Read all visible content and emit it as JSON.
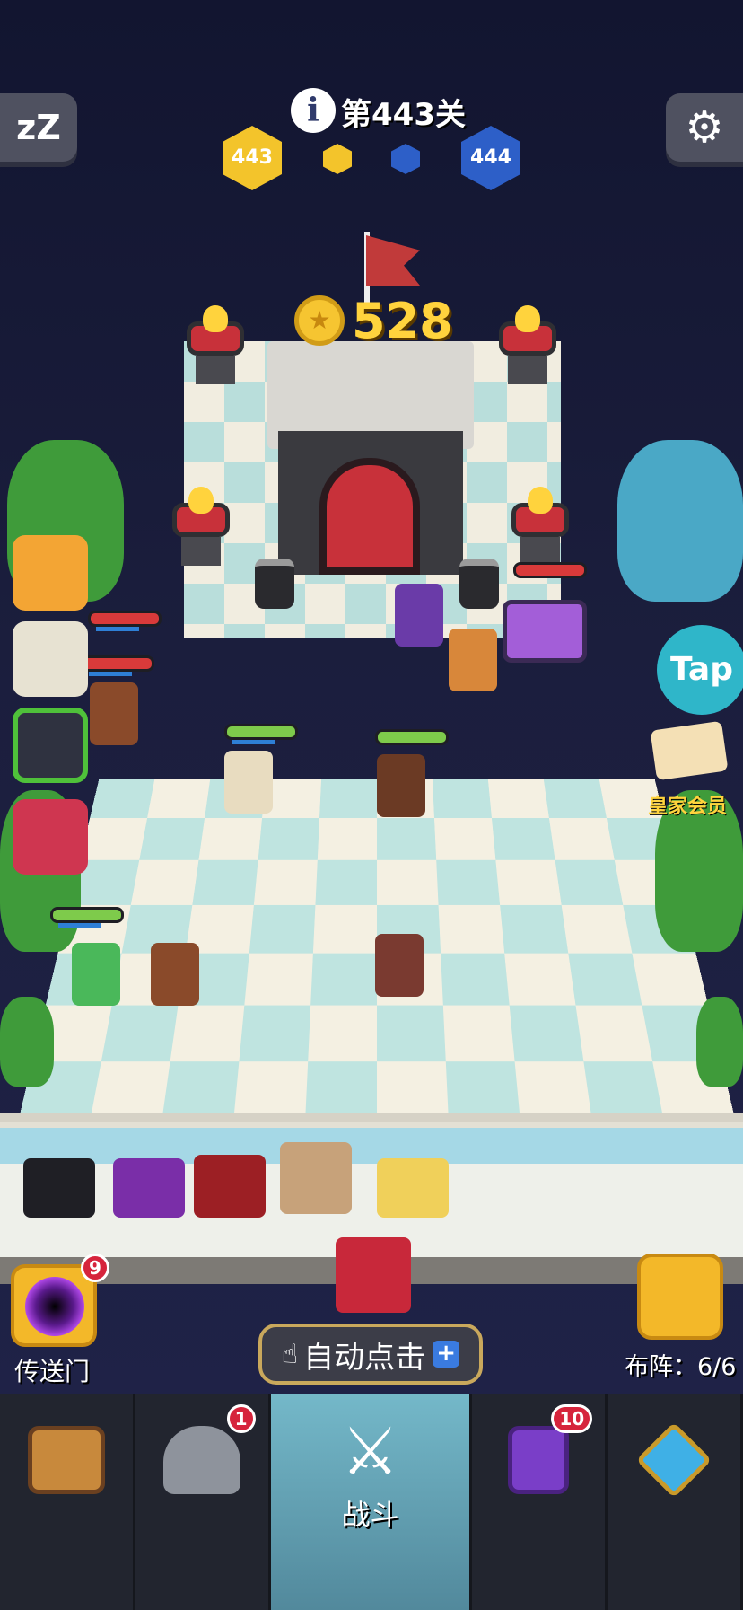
{
  "level": {
    "title": "第443关",
    "current": "443",
    "next": "444"
  },
  "coins": {
    "amount": "528"
  },
  "hud": {
    "sleep_label": "zZ",
    "settings_icon": "gear-icon",
    "info_icon": "info-icon"
  },
  "side": {
    "tap_label": "Tap",
    "royal_label": "皇家会员"
  },
  "controls": {
    "portal_label": "传送门",
    "portal_badge": "9",
    "auto_click_label": "自动点击",
    "auto_click_plus": "+",
    "deploy_label": "布阵：6/6"
  },
  "nav": {
    "tabs": [
      {
        "name": "chest",
        "label": "",
        "badge": ""
      },
      {
        "name": "heroes",
        "label": "",
        "badge": "1"
      },
      {
        "name": "battle",
        "label": "战斗",
        "badge": ""
      },
      {
        "name": "spellbook",
        "label": "",
        "badge": "10"
      },
      {
        "name": "amulet",
        "label": "",
        "badge": ""
      }
    ]
  },
  "colors": {
    "gold": "#ffd33d",
    "hp_green": "#7ecb4b",
    "hp_red": "#d93a3a",
    "accent_blue": "#3a7be0"
  }
}
